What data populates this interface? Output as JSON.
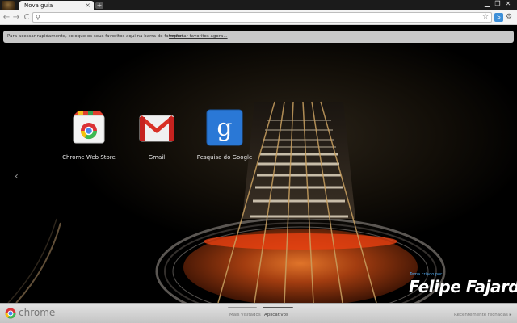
{
  "tabs": [
    {
      "label": "Nova guia",
      "close_glyph": "×"
    }
  ],
  "new_tab_glyph": "+",
  "window_controls": {
    "minimize": "▁",
    "maximize": "❐",
    "close": "✕"
  },
  "toolbar": {
    "back": "←",
    "forward": "→",
    "reload": "C",
    "omnibox_value": "",
    "omnibox_placeholder": ""
  },
  "bookmark_notice": {
    "text": "Para acessar rapidamente, coloque os seus favoritos aqui na barra de favoritos.",
    "link": "Importar favoritos agora..."
  },
  "apps": [
    {
      "label": "Chrome Web Store",
      "icon": "chrome-web-store-icon"
    },
    {
      "label": "Gmail",
      "icon": "gmail-icon"
    },
    {
      "label": "Pesquisa do Google",
      "icon": "google-search-icon"
    }
  ],
  "prev_page_glyph": "‹",
  "theme_brand": {
    "small": "Tema criado por",
    "name": "Felipe Fajardo"
  },
  "footer": {
    "brand": "chrome",
    "sections": [
      {
        "label": "Mais visitados"
      },
      {
        "label": "Aplicativos",
        "active": true
      }
    ],
    "recently_closed": "Recentemente fechadas ▸"
  },
  "colors": {
    "accent": "#4da3e8",
    "footer": "#d0d0d0"
  }
}
